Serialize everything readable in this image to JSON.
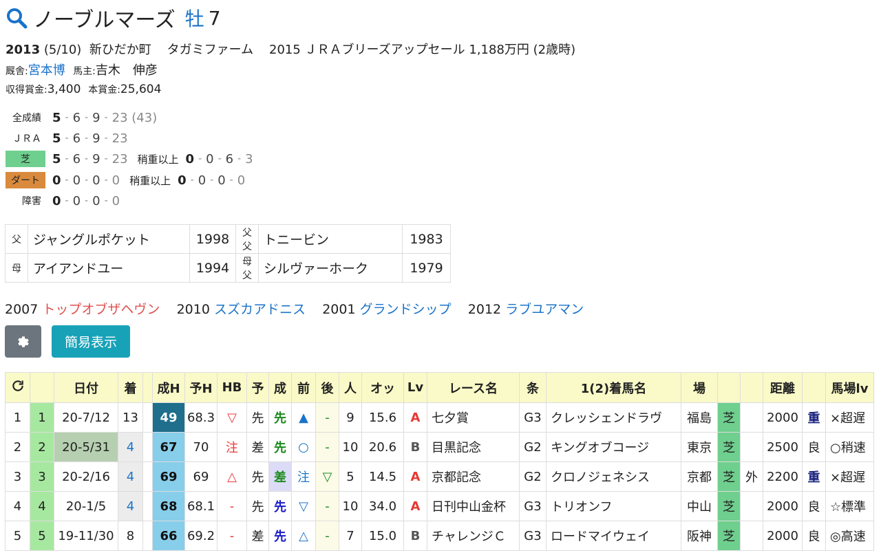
{
  "horse": {
    "name": "ノーブルマーズ",
    "sex": "牡",
    "age": "7"
  },
  "profile": {
    "birth_year": "2013",
    "birth_date": "(5/10)",
    "place": "新ひだか町",
    "breeder": "タガミファーム",
    "sale": "2015 ＪＲＡブリーズアップセール 1,188万円 (2歳時)",
    "stable_label": "厩舎:",
    "trainer": "宮本博",
    "owner_label": "馬主:",
    "owner": "吉木　伸彦",
    "earnings_label": "収得賞金:",
    "earnings": "3,400",
    "prize_label": "本賞金:",
    "prize": "25,604"
  },
  "records": [
    {
      "label": "全成績",
      "w": "5",
      "a": "6",
      "b": "9",
      "c": "23",
      "total": "(43)"
    },
    {
      "label": "ＪＲＡ",
      "w": "5",
      "a": "6",
      "b": "9",
      "c": "23"
    },
    {
      "label": "芝",
      "w": "5",
      "a": "6",
      "b": "9",
      "c": "23",
      "sub_label": "稍重以上",
      "sw": "0",
      "sa": "0",
      "sb": "6",
      "sc": "3"
    },
    {
      "label": "ダート",
      "w": "0",
      "a": "0",
      "b": "0",
      "c": "0",
      "sub_label": "稍重以上",
      "sw": "0",
      "sa": "0",
      "sb": "0",
      "sc": "0"
    },
    {
      "label": "障害",
      "w": "0",
      "a": "0",
      "b": "0",
      "c": "0"
    }
  ],
  "pedigree": {
    "sire_label": "父",
    "sire": "ジャングルポケット",
    "sire_year": "1998",
    "sire_sire_label": "父父",
    "sire_sire": "トニービン",
    "sire_sire_year": "1983",
    "dam_label": "母",
    "dam": "アイアンドユー",
    "dam_year": "1994",
    "dam_sire_label": "母父",
    "dam_sire": "シルヴァーホーク",
    "dam_sire_year": "1979"
  },
  "siblings": [
    {
      "year": "2007",
      "name": "トップオブザヘヴン",
      "color": "#e05050"
    },
    {
      "year": "2010",
      "name": "スズカアドニス",
      "color": "#1a73c9"
    },
    {
      "year": "2001",
      "name": "グランドシップ",
      "color": "#1a73c9"
    },
    {
      "year": "2012",
      "name": "ラブユアマン",
      "color": "#1a73c9"
    }
  ],
  "buttons": {
    "settings_icon": "gear-icon",
    "simple_view": "簡易表示"
  },
  "table": {
    "headers": [
      "",
      "",
      "日付",
      "着",
      "",
      "成H",
      "予H",
      "HB",
      "予",
      "成",
      "前",
      "後",
      "人",
      "オッ",
      "Lv",
      "レース名",
      "条",
      "1(2)着馬名",
      "場",
      "",
      "",
      "距離",
      "",
      "馬場lv"
    ],
    "rows": [
      [
        "1",
        "1",
        "20-7/12",
        "13",
        "",
        "49",
        "68.3",
        "▽",
        "先",
        "先",
        "▲",
        "-",
        "9",
        "15.6",
        "A",
        "七夕賞",
        "G3",
        "クレッシェンドラヴ",
        "福島",
        "芝",
        "",
        "2000",
        "重",
        "×超遅"
      ],
      [
        "2",
        "2",
        "20-5/31",
        "4",
        "",
        "67",
        "70",
        "注",
        "差",
        "先",
        "○",
        "-",
        "10",
        "20.6",
        "B",
        "目黒記念",
        "G2",
        "キングオブコージ",
        "東京",
        "芝",
        "",
        "2500",
        "良",
        "○稍速"
      ],
      [
        "3",
        "3",
        "20-2/16",
        "4",
        "",
        "69",
        "69",
        "△",
        "先",
        "差",
        "注",
        "▽",
        "5",
        "14.5",
        "A",
        "京都記念",
        "G2",
        "クロノジェネシス",
        "京都",
        "芝",
        "外",
        "2200",
        "重",
        "×超遅"
      ],
      [
        "4",
        "4",
        "20-1/5",
        "4",
        "",
        "68",
        "68.1",
        "-",
        "先",
        "先",
        "▽",
        "-",
        "10",
        "34.0",
        "A",
        "日刊中山金杯",
        "G3",
        "トリオンフ",
        "中山",
        "芝",
        "",
        "2000",
        "良",
        "☆標準"
      ],
      [
        "5",
        "5",
        "19-11/30",
        "8",
        "",
        "66",
        "69.2",
        "-",
        "差",
        "先",
        "△",
        "-",
        "7",
        "15.0",
        "B",
        "チャレンジＣ",
        "G3",
        "ロードマイウェイ",
        "阪神",
        "芝",
        "",
        "2000",
        "良",
        "◎高速"
      ]
    ]
  }
}
